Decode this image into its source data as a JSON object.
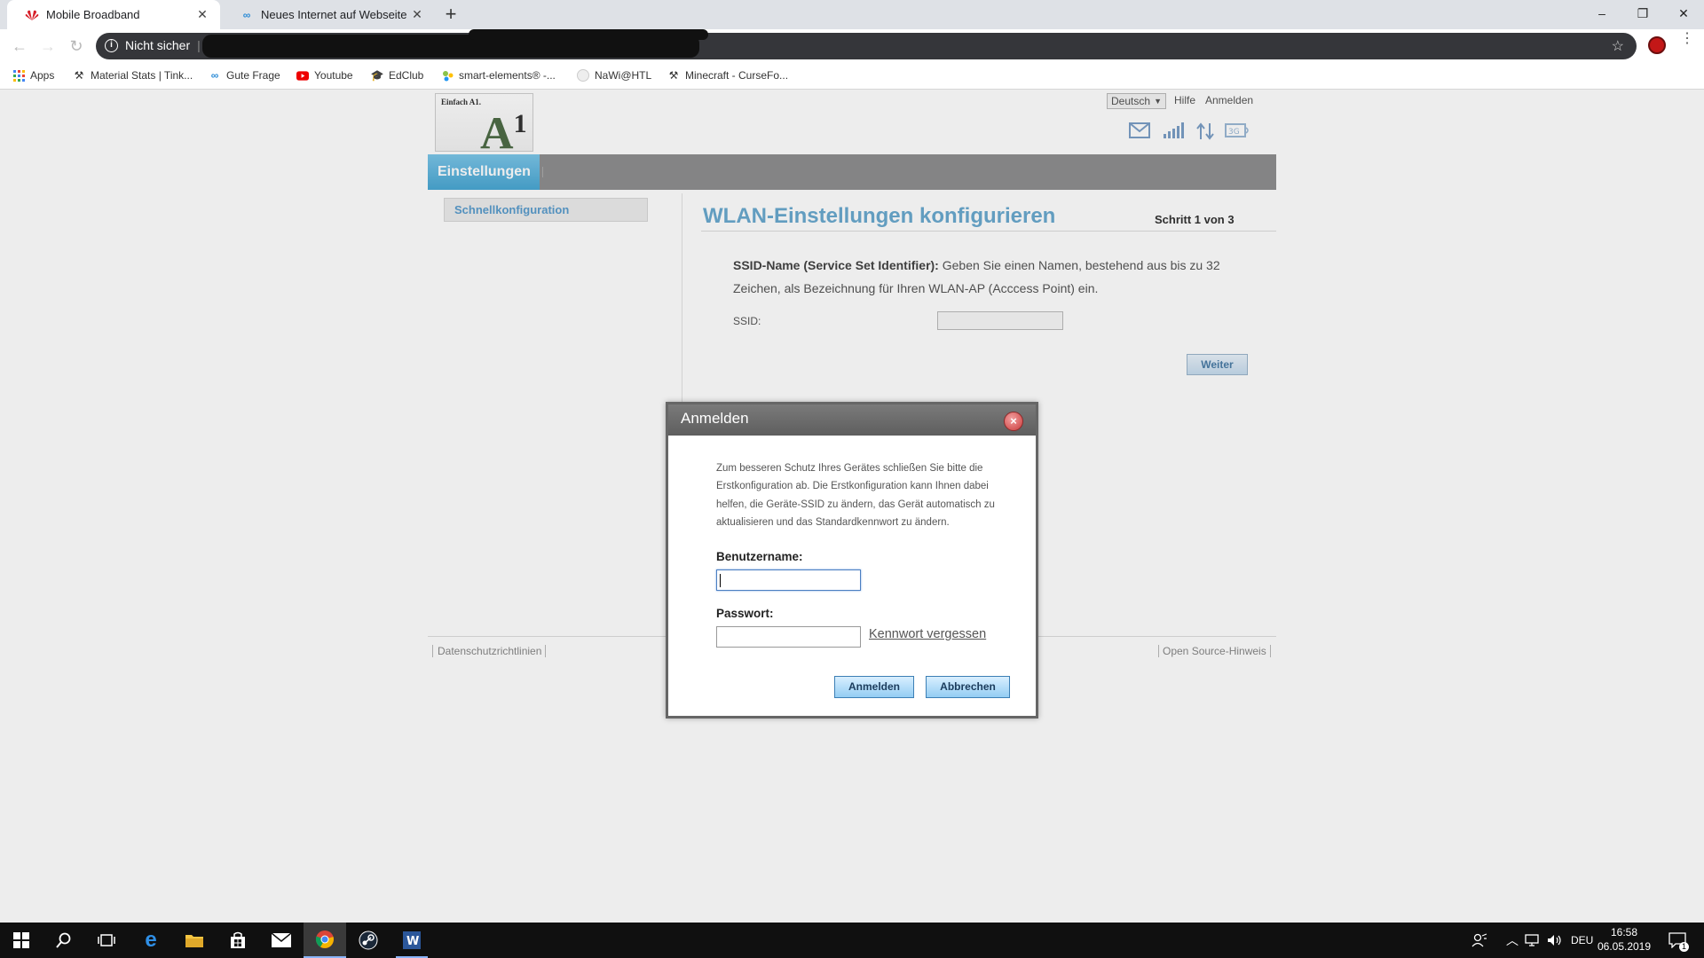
{
  "browser": {
    "tabs": [
      {
        "title": "Mobile Broadband",
        "active": true
      },
      {
        "title": "Neues Internet auf Webseite anm",
        "active": false
      }
    ],
    "new_tab": "+",
    "window_controls": {
      "minimize": "–",
      "restore": "❐",
      "close": "✕"
    },
    "security_label": "Nicht sicher",
    "bookmarks": [
      "Apps",
      "Material Stats | Tink...",
      "Gute Frage",
      "Youtube",
      "EdClub",
      "smart-elements® -...",
      "NaWi@HTL",
      "Minecraft - CurseFo..."
    ]
  },
  "router": {
    "logo_slogan": "Einfach A1.",
    "logo_mark": "A",
    "logo_mark_sup": "1",
    "language": "Deutsch",
    "help": "Hilfe",
    "login": "Anmelden",
    "nav_active": "Einstellungen",
    "sidebar_item": "Schnellkonfiguration",
    "content_title": "WLAN-Einstellungen konfigurieren",
    "step": "Schritt 1 von 3",
    "desc_bold": "SSID-Name (Service Set Identifier):",
    "desc_text": " Geben Sie einen Namen, bestehend aus bis zu 32 Zeichen, als Bezeichnung für Ihren WLAN-AP (Acccess Point) ein.",
    "ssid_label": "SSID:",
    "ssid_value": "",
    "next_button": "Weiter",
    "footer_left": "Datenschutzrichtlinien",
    "footer_right": "Open Source-Hinweis"
  },
  "dialog": {
    "title": "Anmelden",
    "close": "×",
    "text": "Zum besseren Schutz Ihres Gerätes schließen Sie bitte die Erstkonfiguration ab. Die Erstkonfiguration kann Ihnen dabei helfen, die Geräte-SSID zu ändern, das Gerät automatisch zu aktualisieren und das Standardkennwort zu ändern.",
    "username_label": "Benutzername:",
    "username_value": "",
    "password_label": "Passwort:",
    "password_value": "",
    "forgot": "Kennwort vergessen",
    "login_button": "Anmelden",
    "cancel_button": "Abbrechen"
  },
  "taskbar": {
    "language": "DEU",
    "time": "16:58",
    "date": "06.05.2019",
    "notification_count": "1"
  },
  "colors": {
    "accent_blue": "#6aa9cf",
    "nav_active": "#49a7d3",
    "omnibox": "#35363a",
    "taskbar": "#101010"
  }
}
